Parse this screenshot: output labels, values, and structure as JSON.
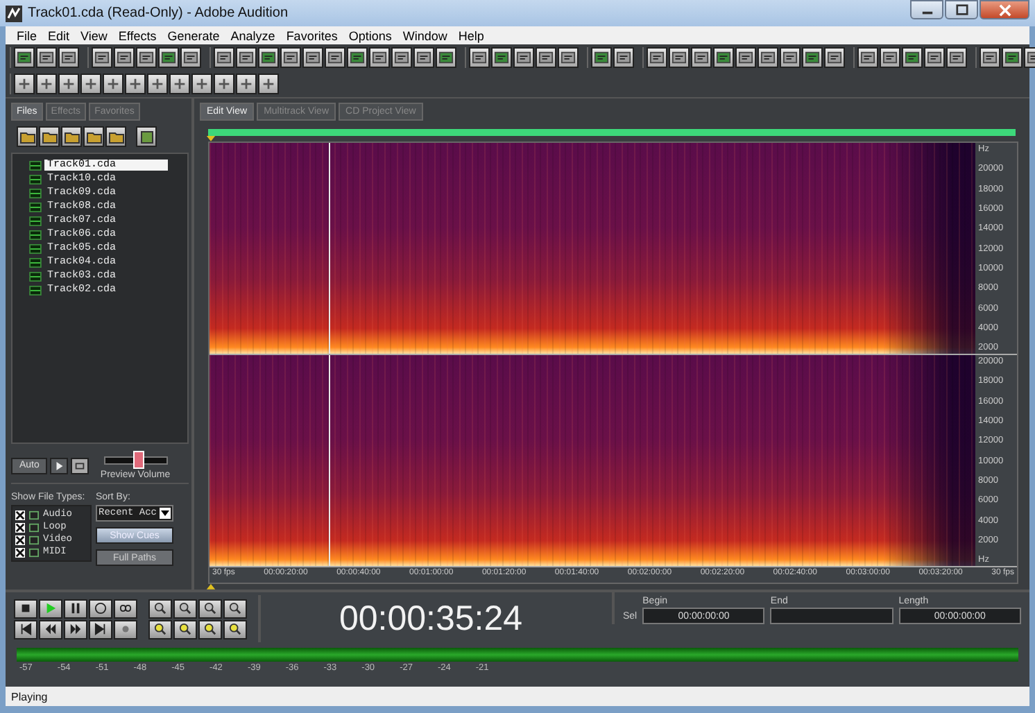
{
  "window": {
    "title": "Track01.cda (Read-Only) - Adobe Audition"
  },
  "menu": [
    "File",
    "Edit",
    "View",
    "Effects",
    "Generate",
    "Analyze",
    "Favorites",
    "Options",
    "Window",
    "Help"
  ],
  "panel_tabs": [
    {
      "label": "Files",
      "selected": true
    },
    {
      "label": "Effects",
      "selected": false
    },
    {
      "label": "Favorites",
      "selected": false
    }
  ],
  "files": [
    {
      "name": "Track01.cda",
      "selected": true
    },
    {
      "name": "Track10.cda",
      "selected": false
    },
    {
      "name": "Track09.cda",
      "selected": false
    },
    {
      "name": "Track08.cda",
      "selected": false
    },
    {
      "name": "Track07.cda",
      "selected": false
    },
    {
      "name": "Track06.cda",
      "selected": false
    },
    {
      "name": "Track05.cda",
      "selected": false
    },
    {
      "name": "Track04.cda",
      "selected": false
    },
    {
      "name": "Track03.cda",
      "selected": false
    },
    {
      "name": "Track02.cda",
      "selected": false
    }
  ],
  "preview": {
    "auto_button": "Auto",
    "volume_label": "Preview Volume",
    "level": 0.55
  },
  "file_types": {
    "label": "Show File Types:",
    "items": [
      {
        "label": "Audio",
        "checked": true
      },
      {
        "label": "Loop",
        "checked": true
      },
      {
        "label": "Video",
        "checked": true
      },
      {
        "label": "MIDI",
        "checked": true
      }
    ]
  },
  "sort": {
    "label": "Sort By:",
    "value": "Recent Acc"
  },
  "panel_buttons": [
    "Show Cues",
    "Full Paths"
  ],
  "view_tabs": [
    {
      "label": "Edit View",
      "selected": true
    },
    {
      "label": "Multitrack View",
      "selected": false
    },
    {
      "label": "CD Project View",
      "selected": false
    }
  ],
  "frequency_axis": [
    [
      "Hz",
      "20000",
      "18000",
      "16000",
      "14000",
      "12000",
      "10000",
      "8000",
      "6000",
      "4000",
      "2000"
    ],
    [
      "20000",
      "18000",
      "16000",
      "14000",
      "12000",
      "10000",
      "8000",
      "6000",
      "4000",
      "2000",
      "Hz"
    ]
  ],
  "timeline": [
    "30 fps",
    "00:00:20:00",
    "00:00:40:00",
    "00:01:00:00",
    "00:01:20:00",
    "00:01:40:00",
    "00:02:00:00",
    "00:02:20:00",
    "00:02:40:00",
    "00:03:00:00",
    "00:03:20:00",
    "30 fps"
  ],
  "time_display": "00:00:35:24",
  "selection": {
    "headers": [
      "Begin",
      "End",
      "Length"
    ],
    "row_label": "Sel",
    "begin": "00:00:00:00",
    "length": "00:00:00:00"
  },
  "meter_scale": [
    "-57",
    "-54",
    "-51",
    "-48",
    "-45",
    "-42",
    "-39",
    "-36",
    "-33",
    "-30",
    "-27",
    "-24",
    "-21"
  ],
  "status_bar": "Playing"
}
